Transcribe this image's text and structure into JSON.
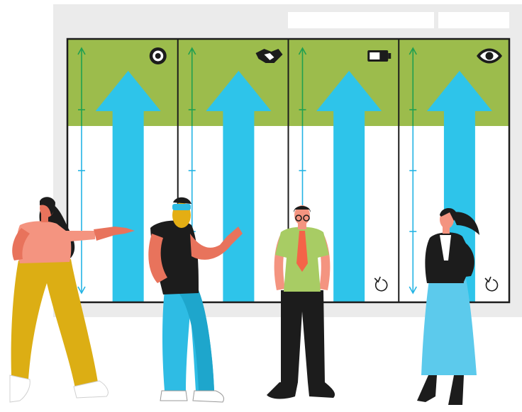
{
  "colors": {
    "backdrop": "#ebebeb",
    "header_green": "#9cbc4c",
    "arrow_blue": "#2ec4ea",
    "scale_blue": "#24b4e4",
    "scale_green": "#20a050",
    "frame": "#1c1c1c"
  },
  "board": {
    "panels": [
      {
        "icon": "target-icon",
        "reset_icon": null
      },
      {
        "icon": "handshake-icon",
        "reset_icon": null
      },
      {
        "icon": "battery-icon",
        "reset_icon": null
      },
      {
        "icon": "eye-icon",
        "reset_icon": "reset-icon"
      }
    ]
  },
  "figures": [
    {
      "name": "woman-pointing-figure",
      "shirt": "#f49480",
      "pants": "#dcae14",
      "hair": "#1c1c1c"
    },
    {
      "name": "man-gesturing-figure",
      "shirt": "#1c1c1c",
      "pants": "#2ebce4",
      "hair": "#e4ae14"
    },
    {
      "name": "man-tie-figure",
      "shirt": "#a8cc64",
      "pants": "#1c1c1c",
      "tie": "#f46448"
    },
    {
      "name": "woman-blazer-figure",
      "jacket": "#1c1c1c",
      "skirt": "#5ccaec",
      "hair": "#1c1c1c"
    }
  ]
}
